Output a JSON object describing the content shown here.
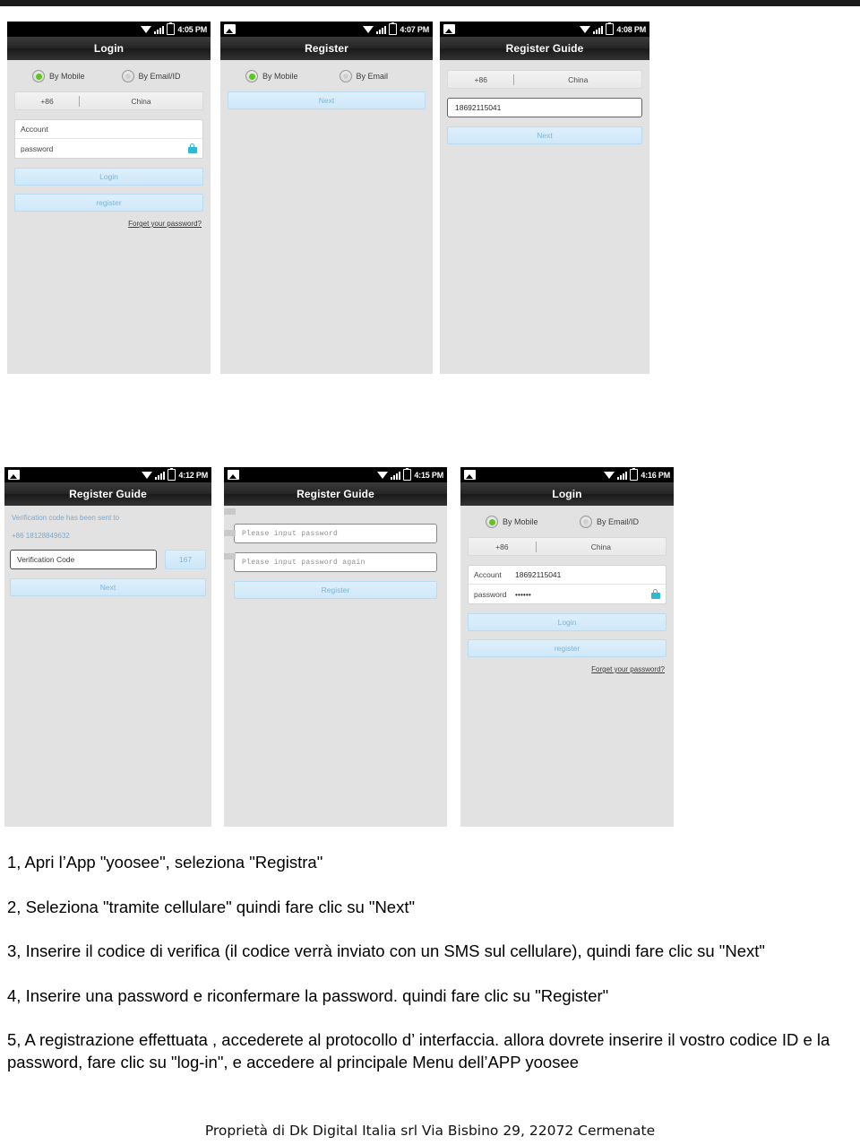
{
  "document": {
    "footer": "Proprietà di Dk Digital Italia srl Via Bisbino 29, 22072 Cermenate"
  },
  "screenshots": [
    {
      "id": "login-empty",
      "status_time": "4:05 PM",
      "title": "Login",
      "radios": [
        {
          "label": "By Mobile",
          "selected": true
        },
        {
          "label": "By Email/ID",
          "selected": false
        }
      ],
      "country_code": "+86",
      "country_name": "China",
      "fields": [
        {
          "key": "Account",
          "value": ""
        },
        {
          "key": "password",
          "value": ""
        }
      ],
      "buttons": [
        "Login",
        "register"
      ],
      "link": "Forget your password?"
    },
    {
      "id": "register-method",
      "status_time": "4:07 PM",
      "title": "Register",
      "radios": [
        {
          "label": "By Mobile",
          "selected": true
        },
        {
          "label": "By Email",
          "selected": false
        }
      ],
      "buttons": [
        "Next"
      ]
    },
    {
      "id": "register-guide-phone",
      "status_time": "4:08 PM",
      "title": "Register Guide",
      "country_code": "+86",
      "country_name": "China",
      "phone_value": "18692115041",
      "buttons": [
        "Next"
      ]
    },
    {
      "id": "register-guide-code",
      "status_time": "4:12 PM",
      "title": "Register Guide",
      "note_line1": "Verification code has been sent to",
      "note_line2": "+86 18128849632",
      "code_placeholder": "Verification Code",
      "code_timer": "167",
      "buttons": [
        "Next"
      ]
    },
    {
      "id": "register-guide-password",
      "status_time": "4:15 PM",
      "title": "Register Guide",
      "password_placeholder_1": "Please input password",
      "password_placeholder_2": "Please input password again",
      "buttons": [
        "Register"
      ]
    },
    {
      "id": "login-filled",
      "status_time": "4:16 PM",
      "title": "Login",
      "radios": [
        {
          "label": "By Mobile",
          "selected": true
        },
        {
          "label": "By Email/ID",
          "selected": false
        }
      ],
      "country_code": "+86",
      "country_name": "China",
      "fields": [
        {
          "key": "Account",
          "value": "18692115041"
        },
        {
          "key": "password",
          "value": "••••••"
        }
      ],
      "buttons": [
        "Login",
        "register"
      ],
      "link": "Forget your password?"
    }
  ],
  "instructions": [
    "1, Apri l’App \"yoosee\", seleziona \"Registra\"",
    "2, Seleziona \"tramite cellulare\" quindi fare clic su \"Next\"",
    "3, Inserire il   codice   di verifica   (il codice verrà inviato con un SMS    sul cellulare), quindi fare clic su \"Next\"",
    "4, Inserire una password e riconfermare la password. quindi fare clic su \"Register\"",
    "5, A registrazione effettuata , accederete al protocollo d’ interfaccia. allora dovrete inserire il vostro codice ID e la password, fare clic su \"log-in\", e    accedere al    principale Menu dell’APP yoosee"
  ]
}
